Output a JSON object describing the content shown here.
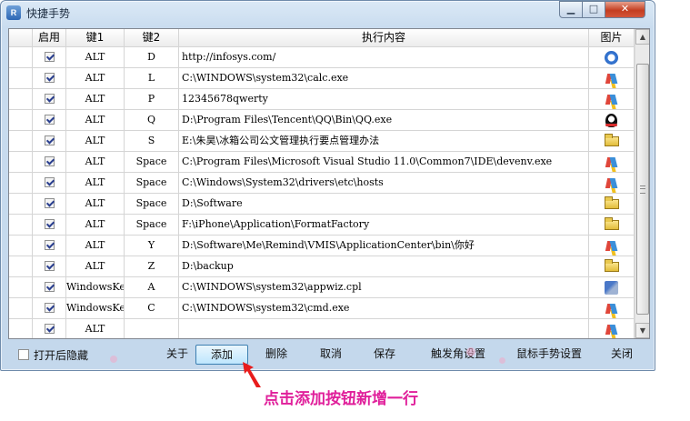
{
  "window": {
    "title": "快捷手势",
    "app_icon": "app-icon"
  },
  "columns": [
    "启用",
    "键1",
    "键2",
    "执行内容",
    "图片"
  ],
  "rows": [
    {
      "enabled": true,
      "key1": "ALT",
      "key2": "D",
      "command": "http://infosys.com/",
      "icon": "ie"
    },
    {
      "enabled": true,
      "key1": "ALT",
      "key2": "L",
      "command": "C:\\WINDOWS\\system32\\calc.exe",
      "icon": "vs"
    },
    {
      "enabled": true,
      "key1": "ALT",
      "key2": "P",
      "command": "12345678qwerty",
      "icon": "vs"
    },
    {
      "enabled": true,
      "key1": "ALT",
      "key2": "Q",
      "command": "D:\\Program Files\\Tencent\\QQ\\Bin\\QQ.exe",
      "icon": "qq"
    },
    {
      "enabled": true,
      "key1": "ALT",
      "key2": "S",
      "command": "E:\\朱昊\\冰箱公司公文管理执行要点管理办法",
      "icon": "folder"
    },
    {
      "enabled": true,
      "key1": "ALT",
      "key2": "Space",
      "command": "C:\\Program Files\\Microsoft Visual Studio 11.0\\Common7\\IDE\\devenv.exe",
      "icon": "vs"
    },
    {
      "enabled": true,
      "key1": "ALT",
      "key2": "Space",
      "command": "C:\\Windows\\System32\\drivers\\etc\\hosts",
      "icon": "vs"
    },
    {
      "enabled": true,
      "key1": "ALT",
      "key2": "Space",
      "command": "D:\\Software",
      "icon": "folder"
    },
    {
      "enabled": true,
      "key1": "ALT",
      "key2": "Space",
      "command": "F:\\iPhone\\Application\\FormatFactory",
      "icon": "folder"
    },
    {
      "enabled": true,
      "key1": "ALT",
      "key2": "Y",
      "command": "D:\\Software\\Me\\Remind\\VMIS\\ApplicationCenter\\bin\\你好",
      "icon": "vs"
    },
    {
      "enabled": true,
      "key1": "ALT",
      "key2": "Z",
      "command": "D:\\backup",
      "icon": "folder"
    },
    {
      "enabled": true,
      "key1": "WindowsKey",
      "key2": "A",
      "command": "C:\\WINDOWS\\system32\\appwiz.cpl",
      "icon": "setup"
    },
    {
      "enabled": true,
      "key1": "WindowsKey",
      "key2": "C",
      "command": "C:\\WINDOWS\\system32\\cmd.exe",
      "icon": "vs"
    },
    {
      "enabled": true,
      "key1": "ALT",
      "key2": "",
      "command": "",
      "icon": "vs"
    }
  ],
  "bottom": {
    "hide_on_open_label": "打开后隐藏",
    "buttons": {
      "about": "关于",
      "add": "添加",
      "delete": "删除",
      "cancel": "取消",
      "save": "保存",
      "corner_settings": "触发角设置",
      "mouse_gesture_settings": "鼠标手势设置",
      "close": "关闭"
    }
  },
  "annotation": "点击添加按钮新增一行",
  "colors": {
    "annotation": "#e0209b",
    "arrow": "#e81c1c",
    "close_button": "#c43d20"
  }
}
